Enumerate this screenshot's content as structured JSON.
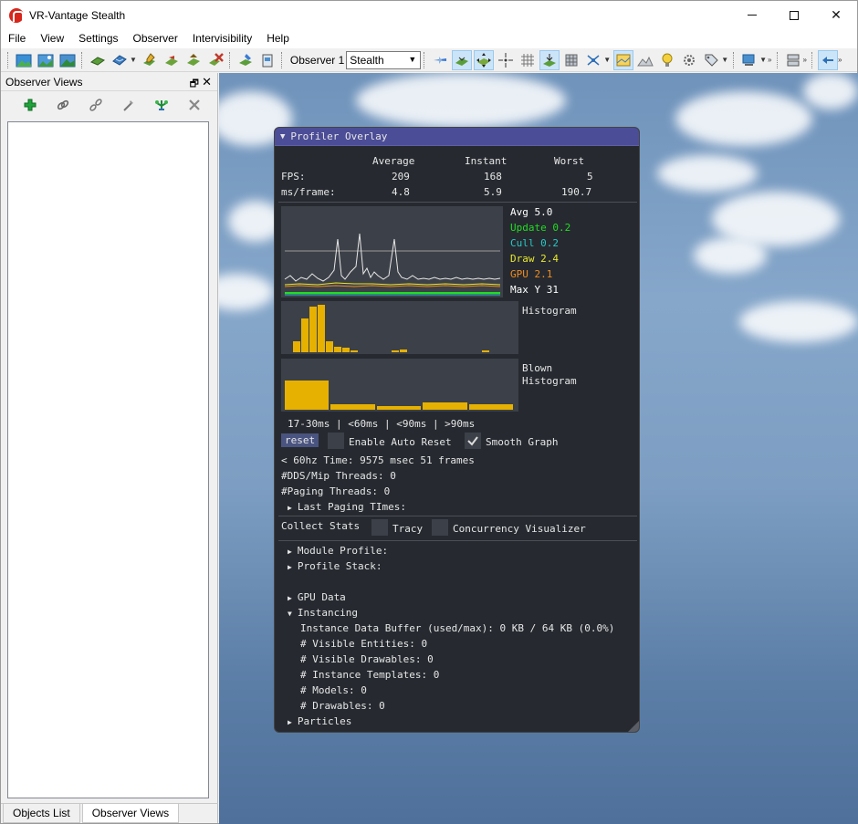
{
  "window": {
    "title": "VR-Vantage Stealth"
  },
  "menu": [
    "File",
    "View",
    "Settings",
    "Observer",
    "Intervisibility",
    "Help"
  ],
  "toolbar": {
    "observer_label": "Observer 1",
    "observer_value": "Stealth"
  },
  "dock": {
    "title": "Observer Views",
    "tabs": [
      "Objects List",
      "Observer Views"
    ],
    "active_tab": "Observer Views"
  },
  "profiler": {
    "title": "Profiler Overlay",
    "table": {
      "headers": [
        "Average",
        "Instant",
        "Worst"
      ],
      "rows": [
        {
          "label": "FPS:",
          "values": [
            "209",
            "168",
            "5"
          ]
        },
        {
          "label": "ms/frame:",
          "values": [
            "4.8",
            "5.9",
            "190.7"
          ]
        }
      ]
    },
    "legend": [
      {
        "text": "Avg 5.0",
        "color": "#ffffff"
      },
      {
        "text": "Update 0.2",
        "color": "#22dd22"
      },
      {
        "text": "Cull 0.2",
        "color": "#28c8c8"
      },
      {
        "text": "Draw 2.4",
        "color": "#e8e82c"
      },
      {
        "text": "GPU 2.1",
        "color": "#f08c1e"
      },
      {
        "text": "Max Y 31",
        "color": "#ffffff"
      }
    ],
    "histogram_label": "Histogram",
    "histogram_values": [
      0.22,
      0.7,
      0.95,
      0.98,
      0.22,
      0.12,
      0.1,
      0.02,
      0,
      0,
      0,
      0,
      0.02,
      0.05,
      0,
      0,
      0,
      0,
      0,
      0,
      0,
      0,
      0,
      0.02
    ],
    "blown_label_1": "Blown",
    "blown_label_2": "Histogram",
    "blown_values": [
      1.0,
      0.18,
      0.12,
      0.26,
      0.18
    ],
    "bucket_labels": "17-30ms | <60ms | <90ms | >90ms",
    "reset_label": "reset",
    "auto_reset_label": "Enable Auto Reset",
    "smooth_graph_label": "Smooth Graph",
    "time_line": "< 60hz Time: 9575 msec 51 frames",
    "dds_threads": "#DDS/Mip Threads: 0",
    "paging_threads": "#Paging Threads: 0",
    "last_paging": "Last Paging TImes:",
    "collect_stats": "Collect Stats",
    "tracy_label": "Tracy",
    "concurrency_label": "Concurrency Visualizer",
    "module_profile": "Module Profile:",
    "profile_stack": "Profile Stack:",
    "gpu_data": "GPU Data",
    "instancing": "Instancing",
    "instancing_lines": [
      "Instance Data Buffer (used/max): 0 KB / 64 KB (0.0%)",
      "# Visible Entities: 0",
      "# Visible Drawables: 0",
      "# Instance Templates: 0",
      "# Models: 0",
      "# Drawables: 0"
    ],
    "particles": "Particles"
  }
}
